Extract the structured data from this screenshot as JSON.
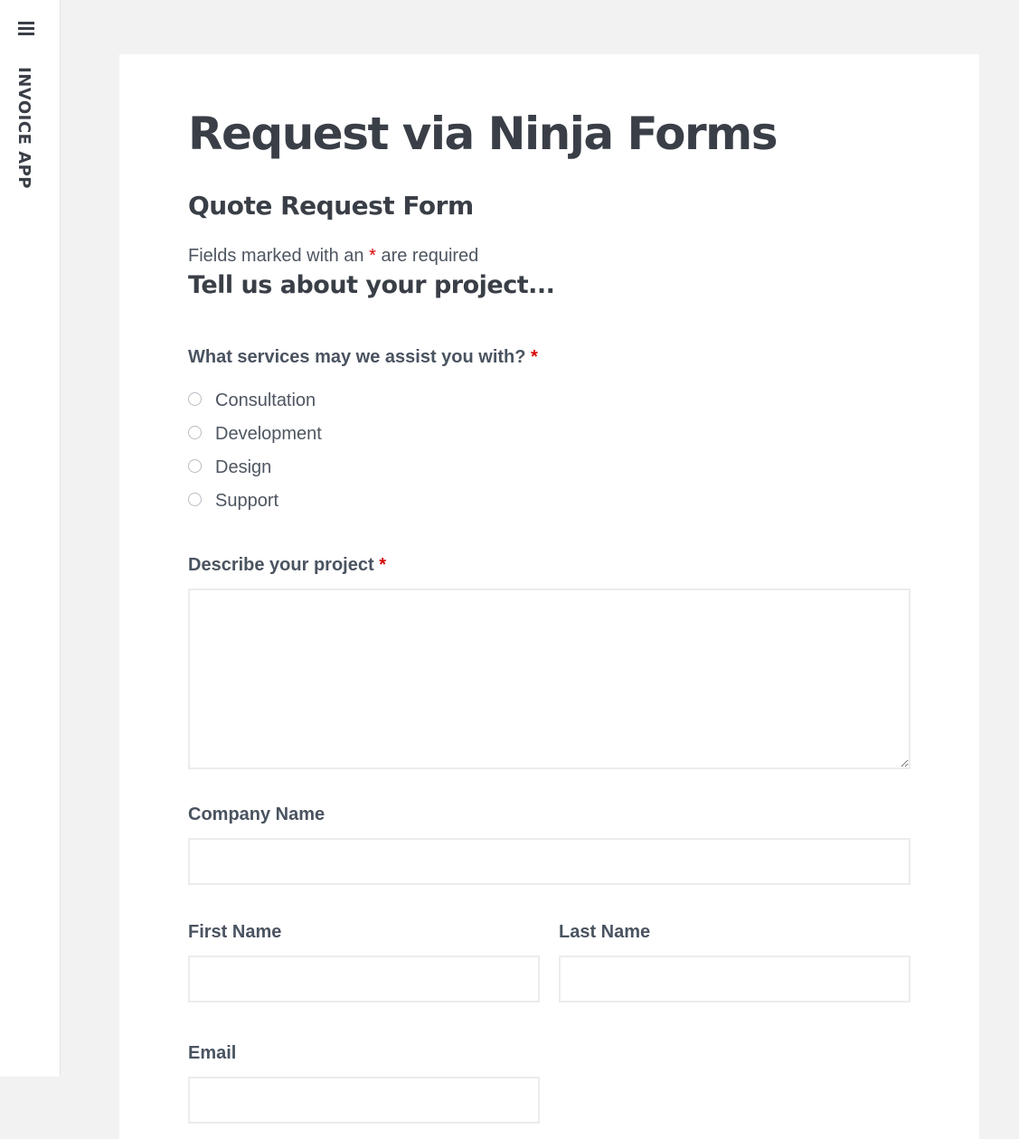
{
  "sidebar": {
    "brand": "INVOICE APP",
    "menu_icon": "hamburger-menu-icon"
  },
  "page": {
    "title": "Request via Ninja Forms"
  },
  "form": {
    "title": "Quote Request Form",
    "required_note_prefix": "Fields marked with an",
    "required_marker": "*",
    "required_note_suffix": "are required",
    "section_heading": "Tell us about your project...",
    "services": {
      "label": "What services may we assist you with?",
      "options": [
        "Consultation",
        "Development",
        "Design",
        "Support"
      ]
    },
    "project": {
      "label": "Describe your project",
      "value": ""
    },
    "company": {
      "label": "Company Name",
      "value": ""
    },
    "first_name": {
      "label": "First Name",
      "value": ""
    },
    "last_name": {
      "label": "Last Name",
      "value": ""
    },
    "email": {
      "label": "Email",
      "value": ""
    }
  },
  "colors": {
    "required": "#d60000",
    "text": "#3a3f47",
    "background": "#f2f2f2"
  }
}
